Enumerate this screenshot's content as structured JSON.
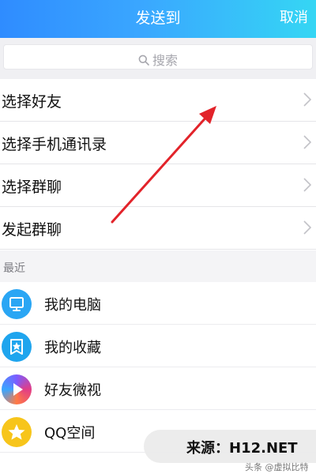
{
  "header": {
    "title": "发送到",
    "cancel_label": "取消"
  },
  "search": {
    "placeholder": "搜索",
    "icon": "search-icon"
  },
  "menu": {
    "items": [
      {
        "label": "选择好友"
      },
      {
        "label": "选择手机通讯录"
      },
      {
        "label": "选择群聊"
      },
      {
        "label": "发起群聊"
      }
    ]
  },
  "recent": {
    "title": "最近",
    "items": [
      {
        "label": "我的电脑",
        "icon": "computer-icon",
        "color": "#2aa6f4"
      },
      {
        "label": "我的收藏",
        "icon": "favorites-icon",
        "color": "#1fa5ee"
      },
      {
        "label": "好友微视",
        "icon": "weishi-icon",
        "color": "#e23d86"
      },
      {
        "label": "QQ空间",
        "icon": "qzone-icon",
        "color": "#f7c51b"
      }
    ]
  },
  "watermark": {
    "text": "来源：H12.NET",
    "sub": "头条 @虚拟比特"
  },
  "colors": {
    "header_start": "#2f8cff",
    "header_end": "#35d6f4",
    "annotation_arrow": "#e2232a"
  }
}
